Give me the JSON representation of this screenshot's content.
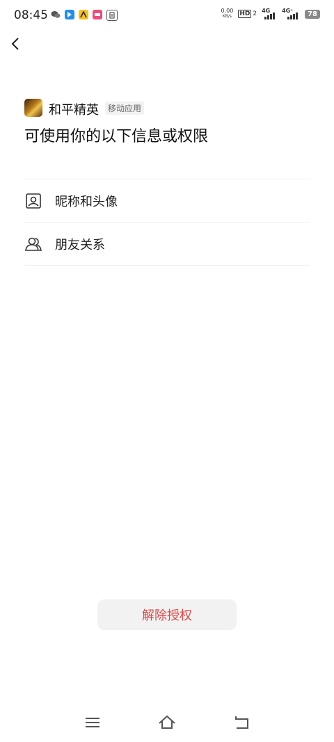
{
  "status_bar": {
    "time": "08:45",
    "net_speed_value": "0.00",
    "net_speed_unit": "KB/s",
    "hd_label": "HD",
    "sim_slot": "2",
    "network_1": "4G",
    "network_2": "4G⁺",
    "battery": "78"
  },
  "app": {
    "name": "和平精英",
    "tag": "移动应用"
  },
  "heading": "可使用你的以下信息或权限",
  "permissions": [
    {
      "label": "昵称和头像",
      "icon": "profile-card-icon"
    },
    {
      "label": "朋友关系",
      "icon": "friends-icon"
    }
  ],
  "revoke_button": "解除授权",
  "nav": {
    "menu_icon": "menu-icon",
    "home_icon": "home-icon",
    "back_icon": "back-nav-icon"
  }
}
